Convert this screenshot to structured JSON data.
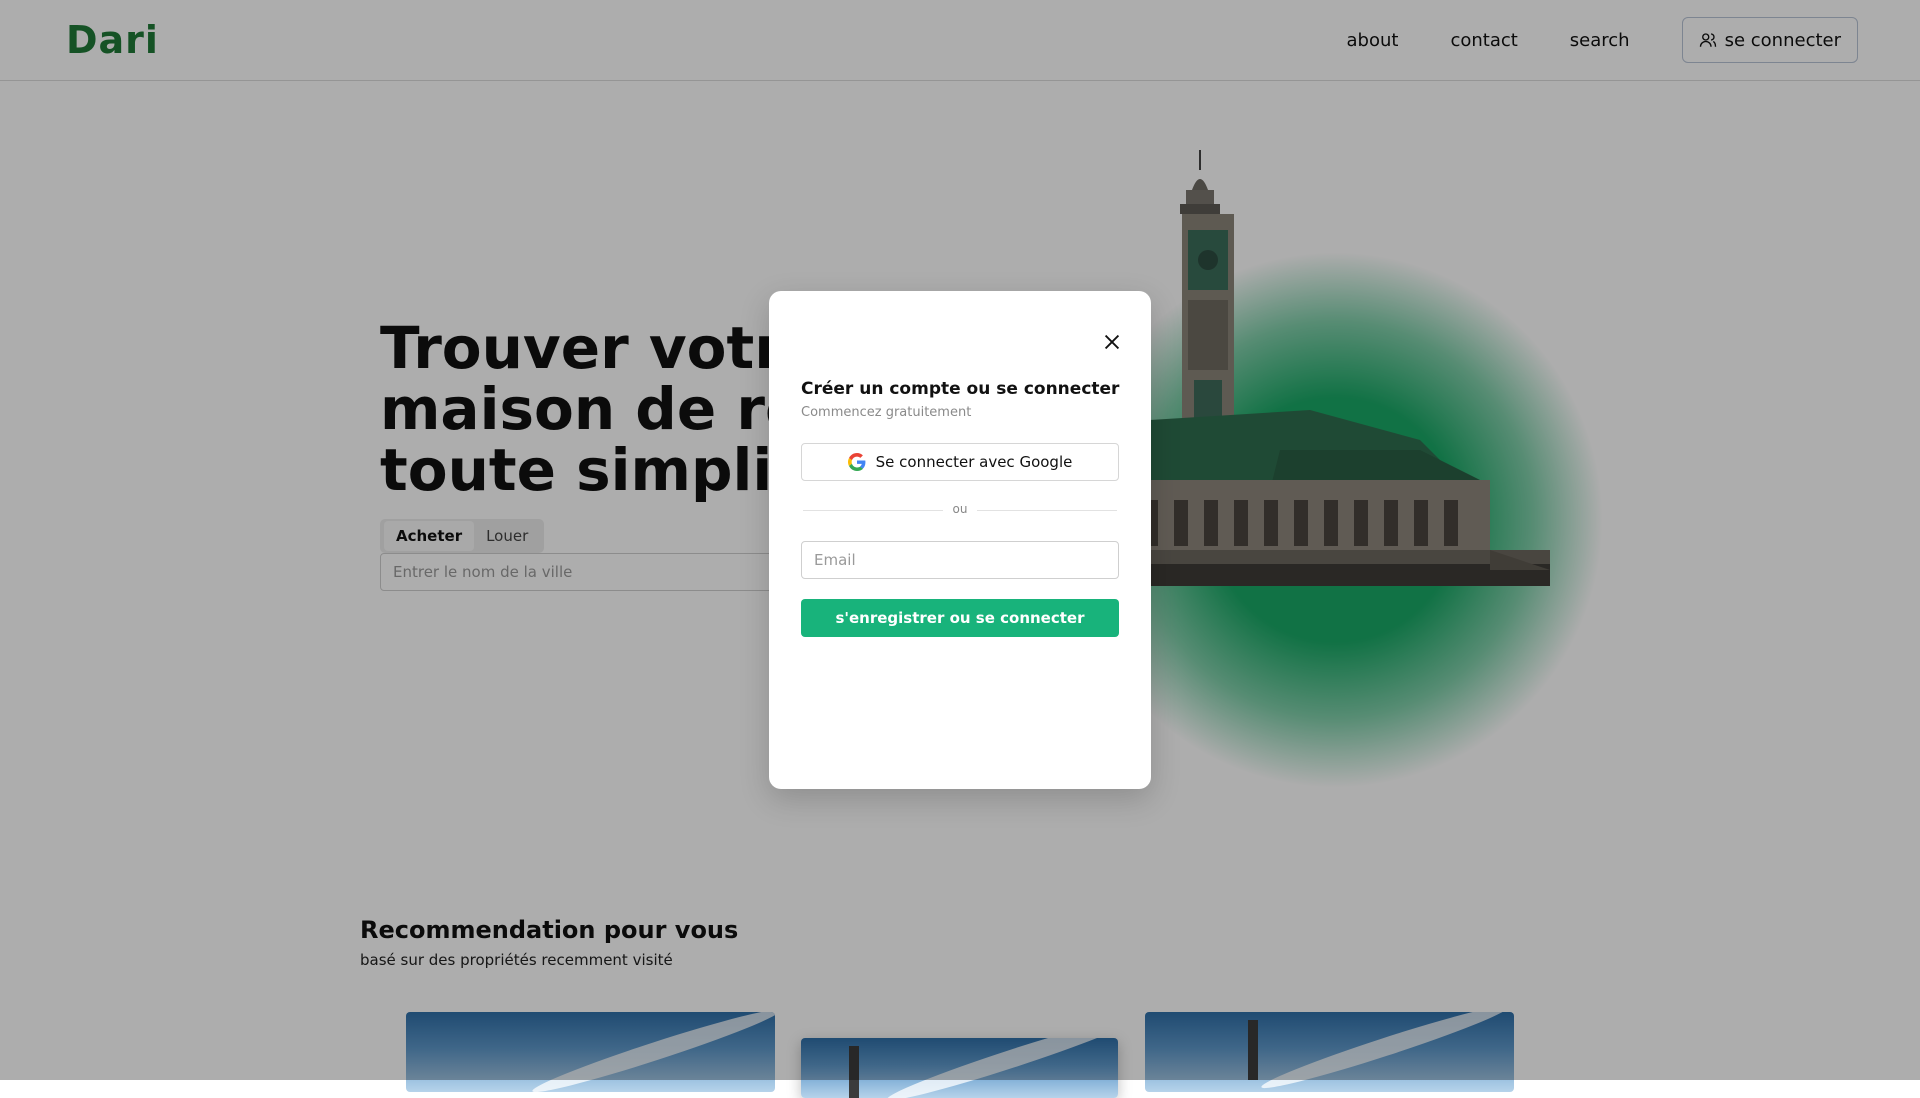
{
  "header": {
    "logo": "Dari",
    "nav": [
      "about",
      "contact",
      "search"
    ],
    "login_label": "se connecter"
  },
  "hero": {
    "title_lines": [
      "Trouver votre",
      "maison de rêve",
      "toute simplicité"
    ],
    "tabs": [
      "Acheter",
      "Louer"
    ],
    "active_tab": "Acheter",
    "city_placeholder": "Entrer le nom de la ville"
  },
  "recommendations": {
    "title": "Recommendation pour vous",
    "subtitle": "basé sur des propriétés recemment visité"
  },
  "modal": {
    "title": "Créer un compte ou se connecter",
    "subtitle": "Commencez gratuitement",
    "google_label": "Se connecter avec Google",
    "divider": "ou",
    "email_placeholder": "Email",
    "submit_label": "s'enregistrer ou se connecter"
  },
  "colors": {
    "brand_green": "#1f7a37",
    "accent_green": "#18b37b",
    "glow_green": "#1aa866",
    "overlay": "rgba(0,0,0,0.32)"
  },
  "icons": [
    "user-icon",
    "close-icon",
    "google-icon"
  ]
}
